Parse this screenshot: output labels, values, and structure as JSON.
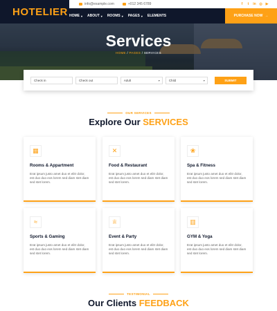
{
  "brand": {
    "name": "HOTELIER"
  },
  "topbar": {
    "email": "info@example.com",
    "phone": "+012 345 6789",
    "social_icons": [
      "facebook-icon",
      "twitter-icon",
      "linkedin-icon",
      "instagram-icon",
      "youtube-icon"
    ]
  },
  "nav": {
    "items": [
      {
        "label": "HOME",
        "dropdown": true
      },
      {
        "label": "ABOUT",
        "dropdown": true
      },
      {
        "label": "ROOMS",
        "dropdown": true
      },
      {
        "label": "PAGES",
        "dropdown": true
      },
      {
        "label": "ELEMENTS",
        "dropdown": false
      }
    ],
    "purchase_label": "PURCHASE NOW",
    "purchase_arrow": "→"
  },
  "hero": {
    "title": "Services",
    "crumbs": {
      "home": "HOME",
      "sep1": " / ",
      "pages": "PAGES",
      "sep2": " / ",
      "current": "SERVICES"
    }
  },
  "booking": {
    "check_in": "Check in",
    "check_out": "Check out",
    "adult": "Adult",
    "child": "Child",
    "submit": "SUBMIT"
  },
  "services": {
    "eyebrow": "OUR SERVICES",
    "title_main": "Explore Our ",
    "title_accent": "SERVICES",
    "cards": [
      {
        "icon": "hotel-icon",
        "glyph": "▦",
        "title": "Rooms & Appartment",
        "text": "Erat ipsum justo amet duo et elitr dolor, est duo duo eos lorem sed diam stet diam sed stet lorem."
      },
      {
        "icon": "utensils-icon",
        "glyph": "✕",
        "title": "Food & Restaurant",
        "text": "Erat ipsum justo amet duo et elitr dolor, est duo duo eos lorem sed diam stet diam sed stet lorem."
      },
      {
        "icon": "spa-icon",
        "glyph": "❀",
        "title": "Spa & Fitness",
        "text": "Erat ipsum justo amet duo et elitr dolor, est duo duo eos lorem sed diam stet diam sed stet lorem."
      },
      {
        "icon": "swimmer-icon",
        "glyph": "≈",
        "title": "Sports & Gaming",
        "text": "Erat ipsum justo amet duo et elitr dolor, est duo duo eos lorem sed diam stet diam sed stet lorem."
      },
      {
        "icon": "glass-cheers-icon",
        "glyph": "♕",
        "title": "Event & Party",
        "text": "Erat ipsum justo amet duo et elitr dolor, est duo duo eos lorem sed diam stet diam sed stet lorem."
      },
      {
        "icon": "dumbbell-icon",
        "glyph": "▥",
        "title": "GYM & Yoga",
        "text": "Erat ipsum justo amet duo et elitr dolor, est duo duo eos lorem sed diam stet diam sed stet lorem."
      }
    ]
  },
  "testimonial": {
    "eyebrow": "TESTIMONIAL",
    "title_main": "Our Clients ",
    "title_accent": "FEEDBACK"
  },
  "colors": {
    "accent": "#fea116",
    "dark": "#0f172b"
  }
}
